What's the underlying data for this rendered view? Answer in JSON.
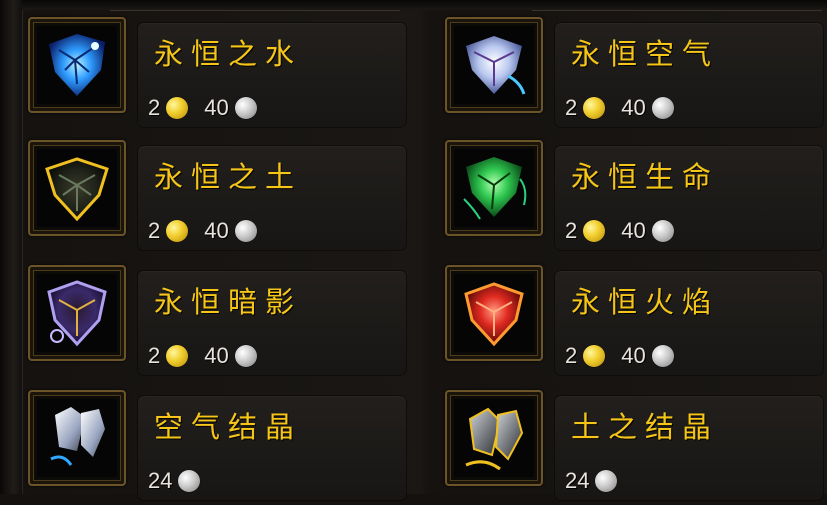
{
  "items": [
    {
      "name": "永恒之水",
      "gold": "2",
      "silver": "40",
      "icon": "eternal-water-icon",
      "color": "#3aa8ff"
    },
    {
      "name": "永恒空气",
      "gold": "2",
      "silver": "40",
      "icon": "eternal-air-icon",
      "color": "#c8d6ff"
    },
    {
      "name": "永恒之土",
      "gold": "2",
      "silver": "40",
      "icon": "eternal-earth-icon",
      "color": "#e0b020"
    },
    {
      "name": "永恒生命",
      "gold": "2",
      "silver": "40",
      "icon": "eternal-life-icon",
      "color": "#2fd060"
    },
    {
      "name": "永恒暗影",
      "gold": "2",
      "silver": "40",
      "icon": "eternal-shadow-icon",
      "color": "#8a70e0"
    },
    {
      "name": "永恒火焰",
      "gold": "2",
      "silver": "40",
      "icon": "eternal-fire-icon",
      "color": "#ff4a30"
    },
    {
      "name": "空气结晶",
      "silver": "24",
      "icon": "crystallized-air-icon",
      "color": "#c0c8d8"
    },
    {
      "name": "土之结晶",
      "silver": "24",
      "icon": "crystallized-earth-icon",
      "color": "#d0a830"
    }
  ]
}
